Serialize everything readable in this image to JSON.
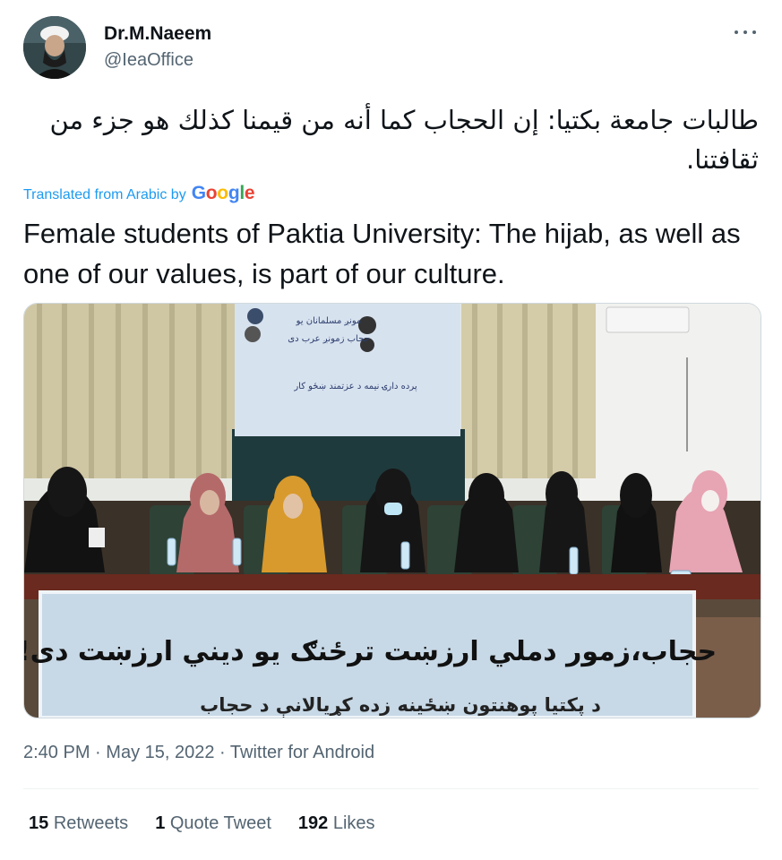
{
  "author": {
    "name": "Dr.M.Naeem",
    "handle": "@IeaOffice",
    "avatar": "avatar-photo"
  },
  "menu_icon": "more-dots-icon",
  "tweet": {
    "original_text": "طالبات جامعة بكتيا: إن الحجاب كما أنه من قيمنا كذلك هو جزء من ثقافتنا.",
    "translated_label": "Translated from Arabic by",
    "translator": "Google",
    "translated_text": "Female students of Paktia University: The hijab, as well as one of our values, is part of our culture."
  },
  "media": {
    "banner_text": "حجاب،زمور دملي ارزښت ترځنګ يو ديني ارزښت دی!",
    "banner_subtext": "د پکتيا پوهنتون ښځينه زده کړيالانې د حجاب",
    "poster_text_1": "مونږ مسلمانان يو",
    "poster_text_2": "حجاب زمونږ عرب دی",
    "poster_text_3": "پرده دارۍ نيمه د عزتمند ښځو کار"
  },
  "meta": {
    "time": "2:40 PM",
    "date": "May 15, 2022",
    "source": "Twitter for Android",
    "separator": "·"
  },
  "stats": {
    "retweets_count": "15",
    "retweets_label": "Retweets",
    "quotes_count": "1",
    "quotes_label": "Quote Tweet",
    "likes_count": "192",
    "likes_label": "Likes"
  }
}
